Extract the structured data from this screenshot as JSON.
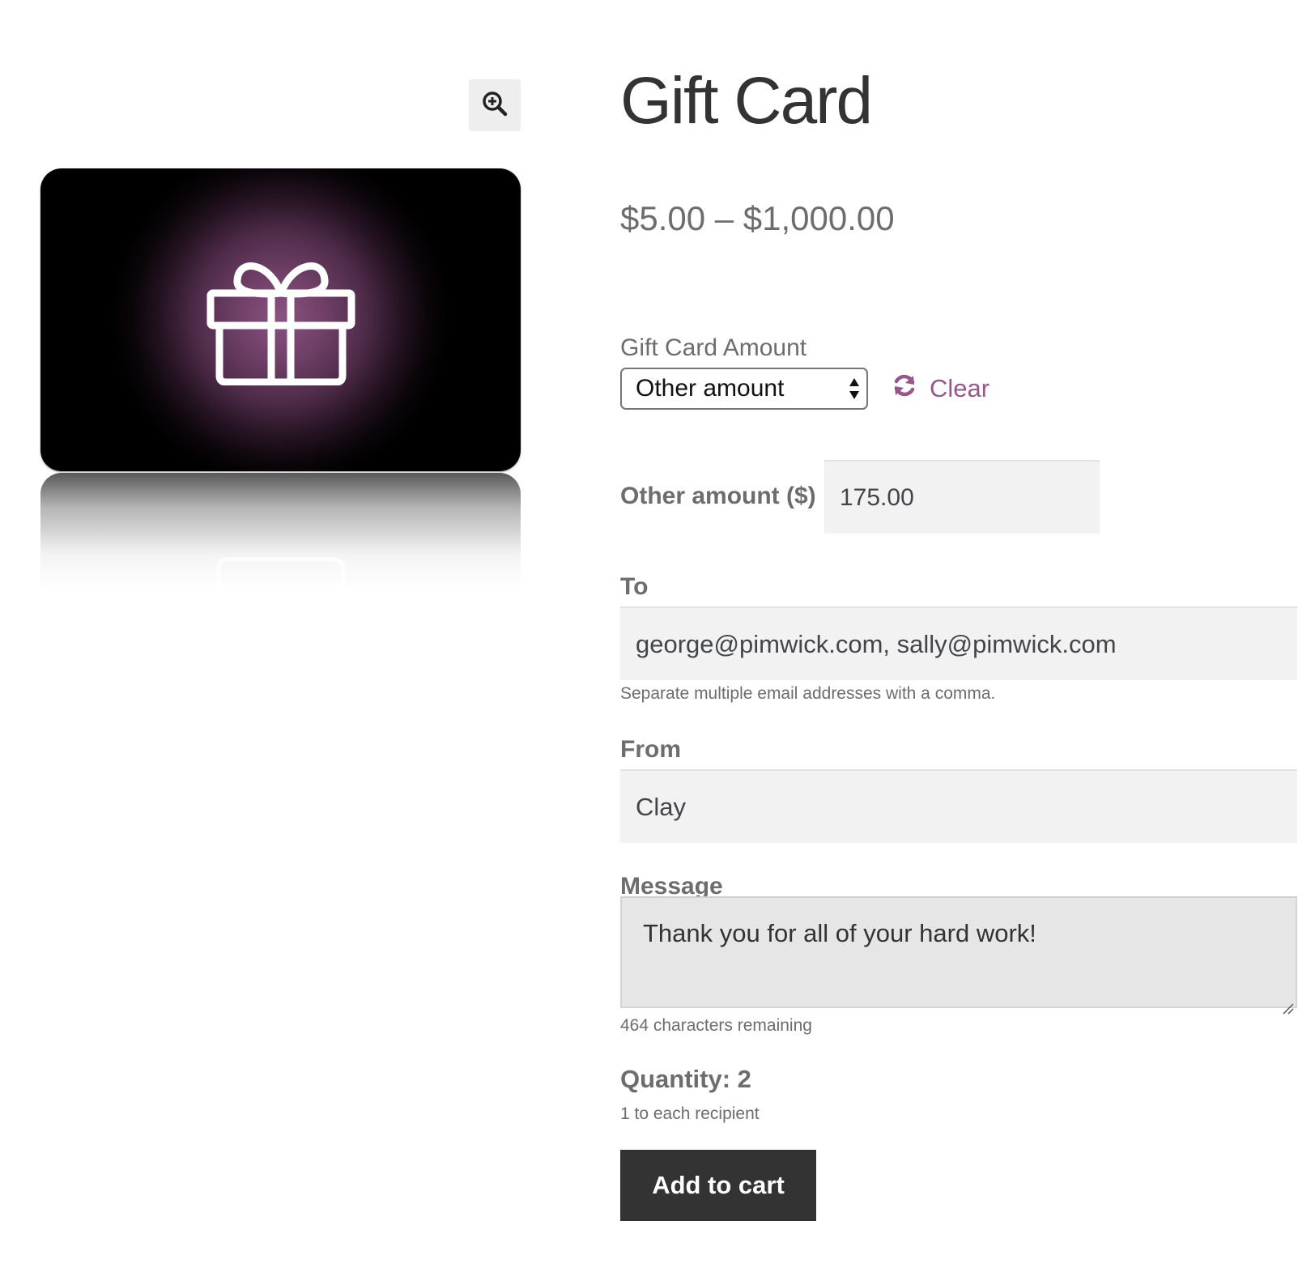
{
  "product": {
    "title": "Gift Card",
    "price": "$5.00 – $1,000.00"
  },
  "gallery": {
    "zoom_icon": "zoom-in-icon",
    "image_icon": "gift-icon",
    "card_color": "#8a5281"
  },
  "form": {
    "amount_label": "Gift Card Amount",
    "amount_selected": "Other amount",
    "clear_label": "Clear",
    "clear_icon": "refresh-icon",
    "other_amount_label": "Other amount ($)",
    "other_amount_value": "175.00",
    "to_label": "To",
    "to_value": "george@pimwick.com, sally@pimwick.com",
    "to_help": "Separate multiple email addresses with a comma.",
    "from_label": "From",
    "from_value": "Clay",
    "message_label": "Message",
    "message_value": "Thank you for all of your hard work!",
    "message_help": "464 characters remaining",
    "quantity_label": "Quantity: 2",
    "quantity_help": "1 to each recipient",
    "add_to_cart_label": "Add to cart"
  },
  "colors": {
    "accent": "#96588a",
    "button_bg": "#333333",
    "input_bg": "#f2f2f2"
  }
}
